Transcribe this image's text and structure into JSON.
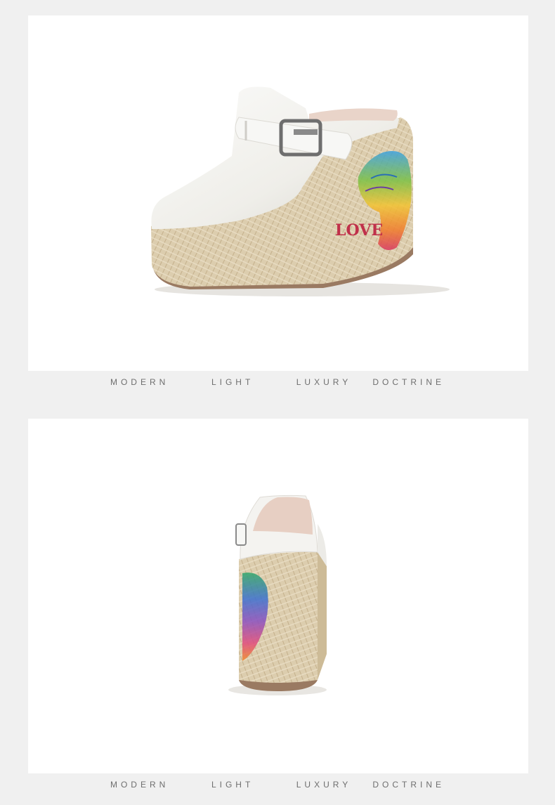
{
  "panels": [
    {
      "image": "white platform wedge mule with buckle strap, side view",
      "caption": "MODERN  LIGHT  LUXURY DOCTRINE",
      "heel_print_text": "LOVE"
    },
    {
      "image": "white platform wedge mule, rear view",
      "caption": "MODERN  LIGHT  LUXURY DOCTRINE"
    }
  ],
  "colors": {
    "page_background": "#f0f0f0",
    "panel_background": "#ffffff",
    "leather": "#f4f2ee",
    "jute": "#d9c9a8",
    "sole": "#9a7a62",
    "caption": "#6e6e6e"
  }
}
